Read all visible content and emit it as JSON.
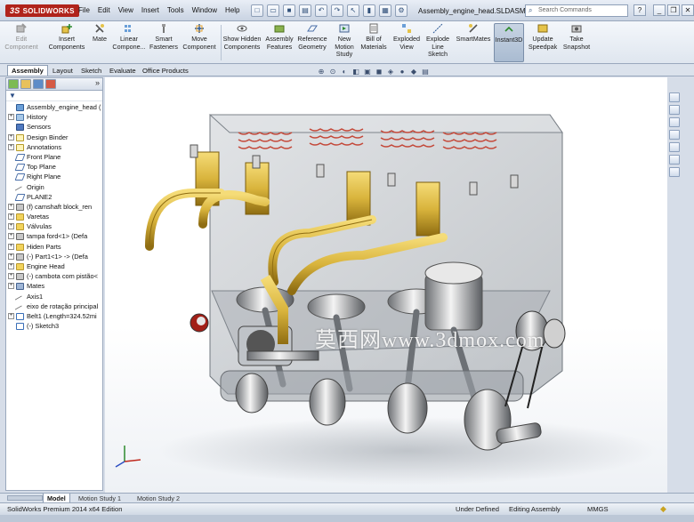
{
  "app": {
    "logo": "SOLIDWORKS",
    "document_title": "Assembly_engine_head.SLDASM *"
  },
  "menu": [
    "File",
    "Edit",
    "View",
    "Insert",
    "Tools",
    "Window",
    "Help"
  ],
  "search": {
    "placeholder": "Search Commands"
  },
  "ribbon": [
    {
      "label": "Edit Component",
      "icon": "edit-component-icon",
      "enabled": false
    },
    {
      "label": "Insert Components",
      "icon": "insert-components-icon",
      "enabled": true
    },
    {
      "label": "Mate",
      "icon": "mate-icon",
      "enabled": true
    },
    {
      "label": "Linear Compone...",
      "icon": "linear-pattern-icon",
      "enabled": true
    },
    {
      "label": "Smart Fasteners",
      "icon": "smart-fasteners-icon",
      "enabled": true
    },
    {
      "label": "Move Component",
      "icon": "move-component-icon",
      "enabled": true
    },
    {
      "label": "Show Hidden Components",
      "icon": "show-hidden-icon",
      "enabled": true
    },
    {
      "label": "Assembly Features",
      "icon": "assembly-features-icon",
      "enabled": true
    },
    {
      "label": "Reference Geometry",
      "icon": "reference-geometry-icon",
      "enabled": true
    },
    {
      "label": "New Motion Study",
      "icon": "motion-study-icon",
      "enabled": true
    },
    {
      "label": "Bill of Materials",
      "icon": "bom-icon",
      "enabled": true
    },
    {
      "label": "Exploded View",
      "icon": "exploded-view-icon",
      "enabled": true
    },
    {
      "label": "Explode Line Sketch",
      "icon": "explode-line-icon",
      "enabled": true
    },
    {
      "label": "SmartMates",
      "icon": "smartmates-icon",
      "enabled": true
    },
    {
      "label": "Instant3D",
      "icon": "instant3d-icon",
      "enabled": true,
      "active": true
    },
    {
      "label": "Update Speedpak",
      "icon": "speedpak-icon",
      "enabled": true
    },
    {
      "label": "Take Snapshot",
      "icon": "snapshot-icon",
      "enabled": true
    }
  ],
  "command_tabs": [
    "Assembly",
    "Layout",
    "Sketch",
    "Evaluate",
    "Office Products"
  ],
  "tree": [
    {
      "label": "Assembly_engine_head (",
      "icon": "asm",
      "expander": ""
    },
    {
      "label": "History",
      "icon": "hist",
      "expander": "+"
    },
    {
      "label": "Sensors",
      "icon": "sensor",
      "expander": ""
    },
    {
      "label": "Design Binder",
      "icon": "note",
      "expander": "+"
    },
    {
      "label": "Annotations",
      "icon": "note",
      "expander": "+"
    },
    {
      "label": "Front Plane",
      "icon": "plane",
      "expander": ""
    },
    {
      "label": "Top Plane",
      "icon": "plane",
      "expander": ""
    },
    {
      "label": "Right Plane",
      "icon": "plane",
      "expander": ""
    },
    {
      "label": "Origin",
      "icon": "axis",
      "expander": ""
    },
    {
      "label": "PLANE2",
      "icon": "plane",
      "expander": ""
    },
    {
      "label": "(f) camshaft block_ren",
      "icon": "part",
      "expander": "+"
    },
    {
      "label": "Varetas",
      "icon": "folder",
      "expander": "+"
    },
    {
      "label": "Válvulas",
      "icon": "folder",
      "expander": "+"
    },
    {
      "label": "tampa ford<1> (Defa",
      "icon": "part",
      "expander": "+"
    },
    {
      "label": "Hiden Parts",
      "icon": "folder",
      "expander": "+"
    },
    {
      "label": "(-) Part1<1> -> (Defa",
      "icon": "part",
      "expander": "+"
    },
    {
      "label": "Engine Head",
      "icon": "folder",
      "expander": "+"
    },
    {
      "label": "(-) cambota com pistão<",
      "icon": "part",
      "expander": "+"
    },
    {
      "label": "Mates",
      "icon": "mate",
      "expander": "+"
    },
    {
      "label": "Axis1",
      "icon": "axis",
      "expander": ""
    },
    {
      "label": "eixo de rotação principal",
      "icon": "axis",
      "expander": ""
    },
    {
      "label": "Belt1 (Length=324.52mi",
      "icon": "sketch",
      "expander": "+"
    },
    {
      "label": "(-) Sketch3",
      "icon": "sketch",
      "expander": ""
    }
  ],
  "bottom_tabs": [
    "Model",
    "Motion Study 1",
    "Motion Study 2"
  ],
  "status": {
    "edition": "SolidWorks Premium 2014 x64 Edition",
    "state": "Under Defined",
    "mode": "Editing Assembly",
    "units": "MMGS"
  },
  "watermark": "莫西网www.3dmox.com",
  "colors": {
    "accent": "#b0231b",
    "brass": "#d9b43c",
    "engine_glass": "#9aa4ad"
  }
}
